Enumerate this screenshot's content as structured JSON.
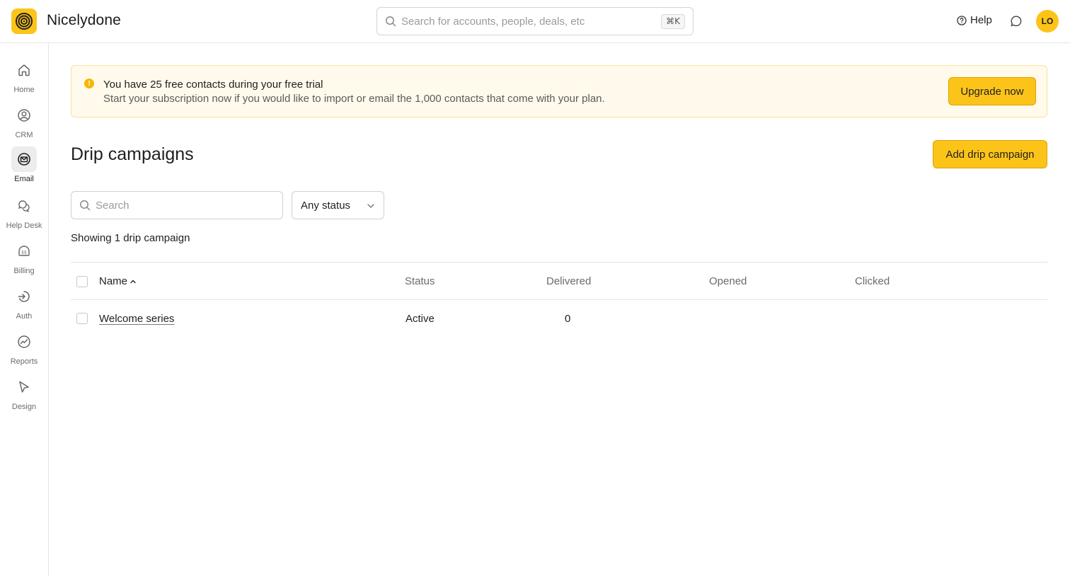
{
  "app": {
    "brand": "Nicelydone",
    "search_placeholder": "Search for accounts, people, deals, etc",
    "search_shortcut": "⌘K",
    "help_label": "Help",
    "avatar_initials": "LO",
    "accent_color": "#fcc419"
  },
  "sidebar": {
    "items": [
      {
        "label": "Home",
        "icon": "home-icon",
        "active": false
      },
      {
        "label": "CRM",
        "icon": "user-circle-icon",
        "active": false
      },
      {
        "label": "Email",
        "icon": "email-icon",
        "active": true
      },
      {
        "label": "Help Desk",
        "icon": "chat-bubbles-icon",
        "active": false
      },
      {
        "label": "Billing",
        "icon": "billing-icon",
        "active": false
      },
      {
        "label": "Auth",
        "icon": "auth-icon",
        "active": false
      },
      {
        "label": "Reports",
        "icon": "reports-icon",
        "active": false
      },
      {
        "label": "Design",
        "icon": "cursor-icon",
        "active": false
      }
    ]
  },
  "banner": {
    "title": "You have 25 free contacts during your free trial",
    "text": "Start your subscription now if you would like to import or email the 1,000 contacts that come with your plan.",
    "button": "Upgrade now"
  },
  "page": {
    "title": "Drip campaigns",
    "add_button": "Add drip campaign",
    "search_placeholder": "Search",
    "status_filter": "Any status",
    "count_text": "Showing 1 drip campaign"
  },
  "table": {
    "columns": [
      "Name",
      "Status",
      "Delivered",
      "Opened",
      "Clicked"
    ],
    "rows": [
      {
        "name": "Welcome series",
        "status": "Active",
        "delivered": "0",
        "opened": "",
        "clicked": ""
      }
    ]
  }
}
